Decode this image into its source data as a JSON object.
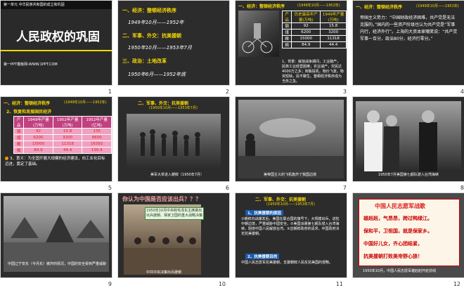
{
  "slides": [
    {
      "number": "1",
      "unit": "第一单元 中华民族共和国的成立和巩固",
      "title": "人民政权的巩固",
      "site": "第一PPT模板网-WWW.1PPT.COM"
    },
    {
      "number": "2",
      "heading1": "一、经济：整顿经济秩序",
      "date1": "1949年10月——1952年",
      "heading2": "二、军事、外交：抗美援朝",
      "date2": "1950年10月——1953年7月",
      "heading3": "三、政治：土地改革",
      "date3": "1950年6月——1952年底"
    },
    {
      "number": "3",
      "heading": "一、经济：整顿经济秩序",
      "date": "(1949年10月——1952年)",
      "table": {
        "headers": [
          "产品",
          "历史最高年产量(万吨)",
          "1949年产量(万吨)"
        ],
        "rows": [
          [
            "钢",
            "92",
            "15.8"
          ],
          [
            "煤",
            "6200",
            "3200"
          ],
          [
            "粮",
            "15000",
            "11318"
          ],
          [
            "棉",
            "84.9",
            "44.4"
          ]
        ]
      },
      "caption": "1、背景：解放战争期间，工业破产，民族工业经营困难；农业减产，灾民达4000万之多；商贩投机，物价飞涨，物资短缺，民不聊生。整顿经济秩序成为当务之急。"
    },
    {
      "number": "4",
      "heading": "一、经济：整顿经济秩序",
      "date": "(1949年10月——1952年)",
      "text": "帝国主义势力：“中国财政经济困难，共产党是无法克服的。”国内的一些资产阶级也认为共产党是“军事内行，经济外行”。上海的大资本家嘲笑说：“共产党军事一百分，政治80分，经济打零分。”"
    },
    {
      "number": "5",
      "heading": "一、经济：整顿经济秩序",
      "date": "(1949年10月——1952年)",
      "sub": "2、恢复和发展国民经济",
      "table": {
        "headers": [
          "产品",
          "1949年产量(万吨)",
          "1952年产量(万吨)",
          "1952年产量(亿吨)"
        ],
        "rows": [
          [
            "钢",
            "92",
            "15.8",
            "135"
          ],
          [
            "煤",
            "6200",
            "3200",
            "6600"
          ],
          [
            "粮",
            "15000",
            "11318",
            "16392"
          ],
          [
            "棉",
            "84.9",
            "44.4",
            "130.4"
          ]
        ]
      },
      "note": "3、意义：为全国开展大规模的经济建设，向工业化目标迈进，奠定了基础。"
    },
    {
      "number": "6",
      "heading": "二、军事、外交：抗美援朝",
      "date": "(1950年10月——1953年7月)",
      "caption": "美军大举进入朝鲜（1950年7月）"
    },
    {
      "number": "7",
      "caption": "美帝国主义的飞机轰炸了我国边境"
    },
    {
      "number": "8",
      "caption": "1950年7月美国第七舰队驶入台湾海峡"
    },
    {
      "number": "9",
      "caption": "中国辽宁安东（今丹东）被炸的情况，中国的安全受到严重威胁"
    },
    {
      "number": "10",
      "question": "你认为中国是否应该出兵？？？",
      "note": "1950年10月中央和毛泽东主席做出出兵援朝、保家卫国的重大战略决策",
      "caption": "中共中央决策出兵援朝"
    },
    {
      "number": "11",
      "heading": "二、军事、外交：抗美援朝",
      "date": "(1950年10月——1953年7月)",
      "sub1": "1、抗美援朝的原因",
      "text1": "①朝鲜内战爆发后，美国在联合国的旗号下，大规模出兵，进犯中朝边境，严重威胁中国安全。②美国派遣第七舰队侵入台湾海峡，阻挠中国人民解放台湾。③应朝鲜政府的请求，中国政府决定抗美援朝。",
      "sub2": "2、抗美援朝目的",
      "text2": "中国人民志愿军抗美援朝，支援朝鲜人民反抗美国的侵略。"
    },
    {
      "number": "12",
      "title": "中国人民志愿军战歌",
      "lines": [
        "雄赳赳，气昂昂，跨过鸭绿江。",
        "保和平，卫祖国，就是保家乡。",
        "中国好儿女，齐心团结紧，",
        "抗美援朝打败美帝野心狼！"
      ],
      "caption": "1950年10月，中国人民志愿军雄赳赳开赴前线"
    }
  ],
  "colors": {
    "accent_yellow": "#f5d800",
    "accent_red": "#e02020",
    "slide_bg": "#2c2c2c"
  }
}
